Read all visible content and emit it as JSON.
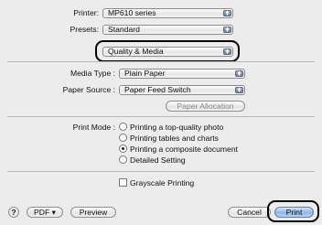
{
  "printer": {
    "label": "Printer:",
    "value": "MP610 series"
  },
  "presets": {
    "label": "Presets:",
    "value": "Standard"
  },
  "panel_menu": {
    "value": "Quality & Media"
  },
  "media_type": {
    "label": "Media Type :",
    "value": "Plain Paper"
  },
  "paper_source": {
    "label": "Paper Source :",
    "value": "Paper Feed Switch"
  },
  "paper_allocation_label": "Paper Allocation",
  "print_mode": {
    "label": "Print Mode :",
    "options": [
      {
        "label": "Printing a top-quality photo",
        "selected": false
      },
      {
        "label": "Printing tables and charts",
        "selected": false
      },
      {
        "label": "Printing a composite document",
        "selected": true
      },
      {
        "label": "Detailed Setting",
        "selected": false
      }
    ]
  },
  "grayscale": {
    "label": "Grayscale Printing",
    "checked": false
  },
  "footer": {
    "help_label": "?",
    "pdf_label": "PDF ▾",
    "preview_label": "Preview",
    "cancel_label": "Cancel",
    "print_label": "Print"
  }
}
